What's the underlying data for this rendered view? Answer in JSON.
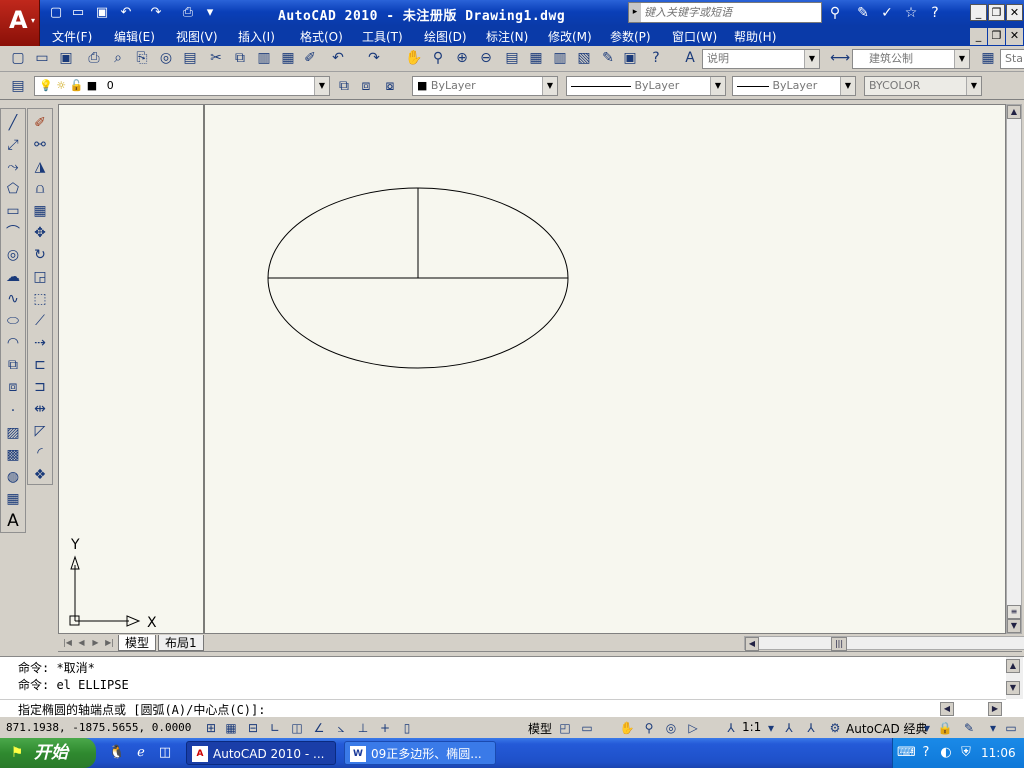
{
  "window": {
    "title": "AutoCAD 2010 - 未注册版  Drawing1.dwg",
    "search_placeholder": "键入关键字或短语"
  },
  "menu": {
    "items": [
      "文件(F)",
      "编辑(E)",
      "视图(V)",
      "插入(I)",
      "格式(O)",
      "工具(T)",
      "绘图(D)",
      "标注(N)",
      "修改(M)",
      "参数(P)",
      "窗口(W)",
      "帮助(H)"
    ]
  },
  "toolbar": {
    "text_style": "说明",
    "dim_style": "建筑公制",
    "table_style_prefix": "Sta"
  },
  "layers": {
    "current_layer": "0",
    "color": "ByLayer",
    "linetype": "ByLayer",
    "lineweight": "ByLayer",
    "plotstyle": "BYCOLOR"
  },
  "ucs": {
    "x_label": "X",
    "y_label": "Y"
  },
  "tabs": {
    "model": "模型",
    "layout1": "布局1"
  },
  "command": {
    "line1": "命令: *取消*",
    "line2": "命令: el ELLIPSE",
    "prompt": "指定椭圆的轴端点或 [圆弧(A)/中心点(C)]:"
  },
  "status": {
    "coords": "871.1938,  -1875.5655, 0.0000",
    "model_label": "模型",
    "scale": "1:1",
    "workspace": "AutoCAD 经典"
  },
  "taskbar": {
    "start": "开始",
    "tasks": [
      "AutoCAD 2010 - ...",
      "09正多边形、椭圆..."
    ],
    "clock": "11:06"
  }
}
